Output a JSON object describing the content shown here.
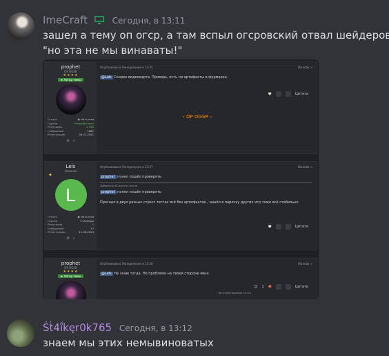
{
  "msg1": {
    "username": "ImeCraft",
    "timestamp": "Сегодня, в 13:11",
    "lines": [
      "зашел а тему оп огср, а там вспыл огсровский отвал шейдеров",
      "\"но эта не мы винаваты!\""
    ]
  },
  "forum": {
    "post1": {
      "name": "prophet",
      "rank": "OP OGSR",
      "stars": "★★★★",
      "badge": "★ Автор темы",
      "stats": [
        [
          "Статус",
          "◉ Не в сети"
        ],
        [
          "Группа",
          "Разработчики"
        ],
        [
          "Репутация",
          "1 036"
        ],
        [
          "Сообщений",
          "1882"
        ],
        [
          "Регистрация",
          "06.01.2021"
        ]
      ],
      "meta": "Опубликовано Понедельник в 13:45",
      "share": "Жалоба  ⋖",
      "text_tag": "@Lels",
      "text": " Скорее видеокарта. Проверь, есть ли артефакты в фурмарке.",
      "quote": "Цитата",
      "watermark": "‹ OP OGSR ›"
    },
    "post2": {
      "name": "Lels",
      "rank": "Новичок",
      "avatar_letter": "L",
      "stats": [
        [
          "Статус",
          "◉ Не в сети"
        ],
        [
          "Группа",
          "Сталкеры"
        ],
        [
          "Репутация",
          "3"
        ],
        [
          "Сообщений",
          "17"
        ],
        [
          "Регистрация",
          "11.08.2024"
        ]
      ],
      "meta": "Опубликовано Понедельник в 13:47",
      "share": "Жалоба  ⋖",
      "line1_tag": "prophet",
      "line1": " понял пошёл проверять",
      "added": "Добавлено 48 минуты спустя",
      "line2_tag": "prophet",
      "line2": " понял пошёл проверять",
      "line3": "Прогнал в двух разных стресс тестах всё без артефактов , зашёл в парочку других игр тоже всё стабильно",
      "quote": "Цитата"
    },
    "post3": {
      "name": "prophet",
      "rank": "OP OGSR",
      "stars": "★★★★",
      "badge": "★ Автор темы",
      "meta": "Опубликовано Понедельник в 13:56",
      "share": "Жалоба  ⋖",
      "text_tag": "@Lels",
      "text": " Не знаю тогда. Но проблема на твоей стороне явно.",
      "reaction_count": "1",
      "reacted": "Вы отреагировали на это",
      "quote": "Цитата"
    }
  },
  "msg2": {
    "username": "Ṡṫ4ḯkęr0k765",
    "timestamp": "Сегодня, в 13:12",
    "line": "знаем мы этих немывиноватых"
  },
  "colors": {
    "background": "#313338",
    "accent_green": "#23a55a",
    "orange": "#e8951d"
  }
}
